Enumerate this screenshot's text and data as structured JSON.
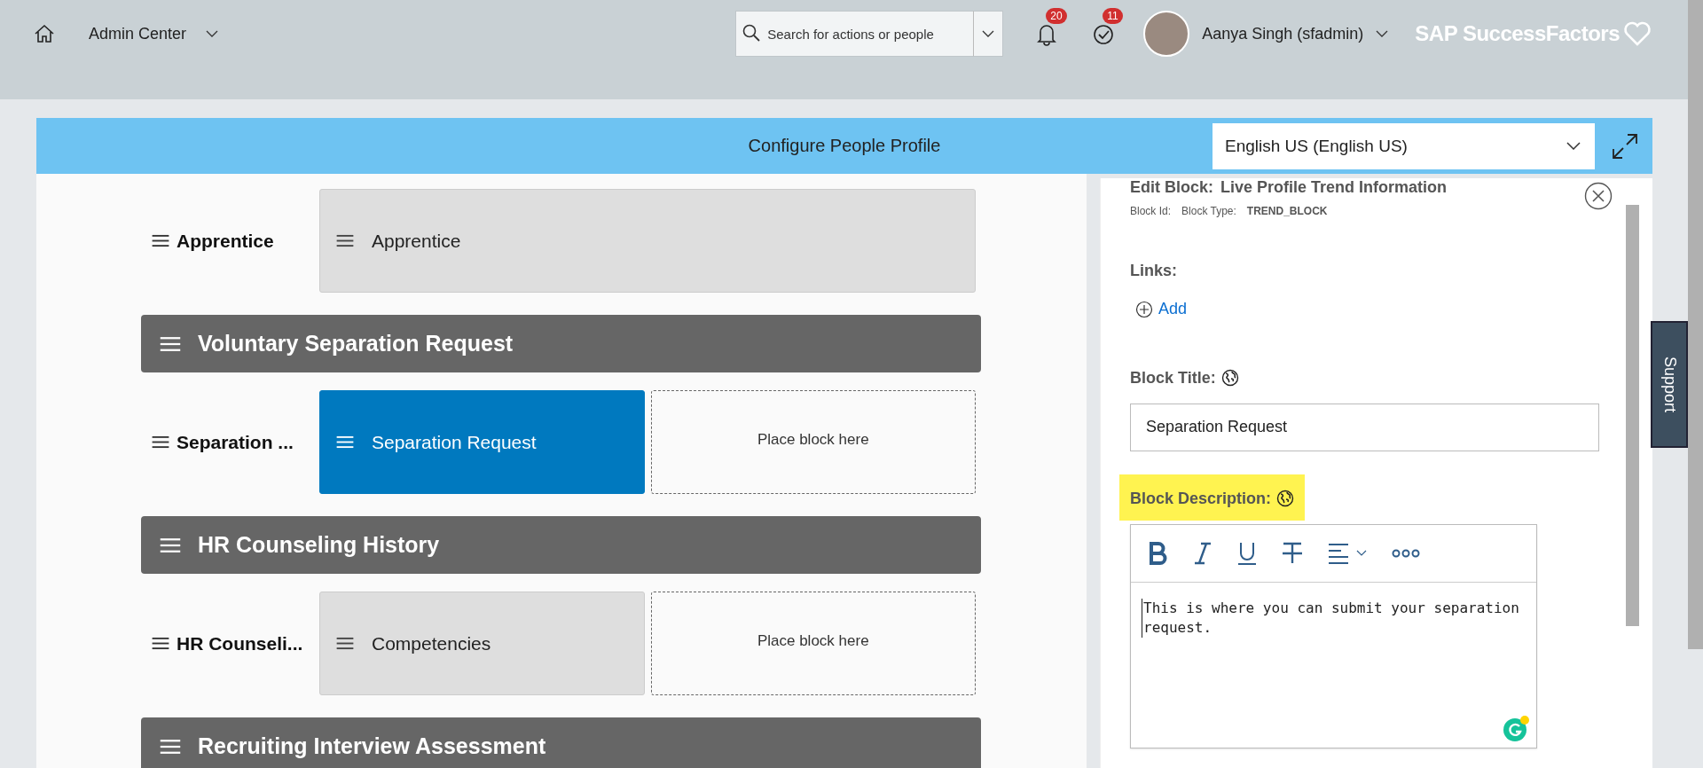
{
  "header": {
    "home_menu": "Admin Center",
    "search": {
      "placeholder": "Search for actions or people"
    },
    "notifications_count": "20",
    "todos_count": "11",
    "user_name": "Aanya Singh (sfadmin)",
    "logo": "SAP SuccessFactors"
  },
  "title_bar": {
    "title": "Configure People Profile",
    "language": "English US (English US)"
  },
  "layout": [
    {
      "kind": "row",
      "label": "Apprentice",
      "blocks": [
        {
          "kind": "block",
          "label": "Apprentice",
          "selected": false
        }
      ]
    },
    {
      "kind": "section",
      "title": "Voluntary Separation Request"
    },
    {
      "kind": "row",
      "label": "Separation ...",
      "blocks": [
        {
          "kind": "block",
          "label": "Separation Request",
          "selected": true
        },
        {
          "kind": "placeholder",
          "label": "Place block here"
        }
      ]
    },
    {
      "kind": "section",
      "title": "HR Counseling History"
    },
    {
      "kind": "row",
      "label": "HR Counseli...",
      "blocks": [
        {
          "kind": "block",
          "label": "Competencies",
          "selected": false
        },
        {
          "kind": "placeholder",
          "label": "Place block here"
        }
      ]
    },
    {
      "kind": "section",
      "title": "Recruiting Interview Assessment"
    }
  ],
  "edit_panel": {
    "heading_label": "Edit Block:",
    "heading_value": "Live Profile Trend Information",
    "block_id_label": "Block Id:",
    "block_type_label": "Block Type:",
    "block_type_value": "TREND_BLOCK",
    "links_label": "Links:",
    "add_link": "Add",
    "block_title_label": "Block Title:",
    "block_title_value": "Separation Request",
    "block_description_label": "Block Description:",
    "block_description_highlighted": true,
    "block_description_value": "This is where you can submit your separation request."
  },
  "support_tab": "Support"
}
